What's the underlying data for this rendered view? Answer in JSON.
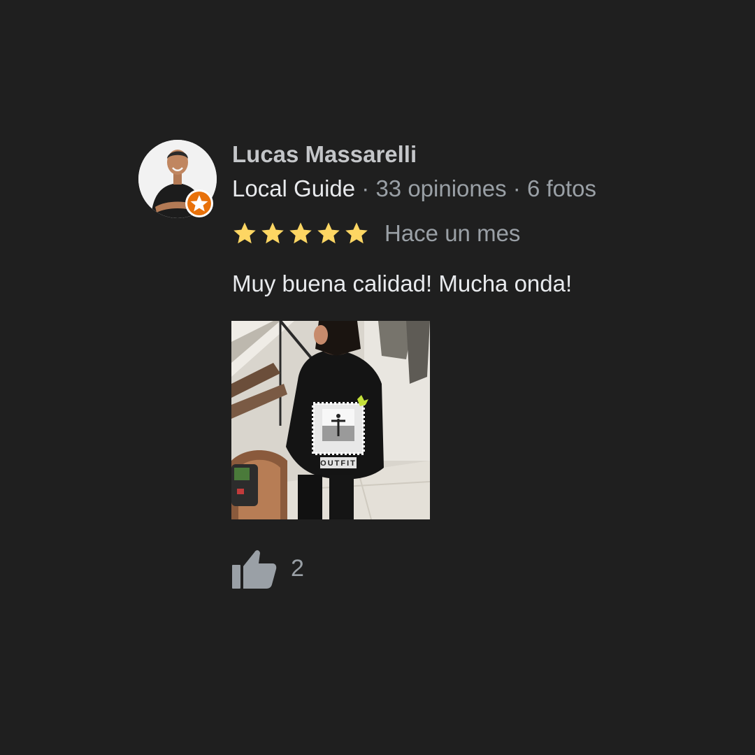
{
  "review": {
    "author_name": "Lucas Massarelli",
    "guide_label": "Local Guide",
    "separator": " · ",
    "reviews_count": "33 opiniones",
    "photos_count": "6 fotos",
    "rating": 5,
    "max_rating": 5,
    "time_ago": "Hace un mes",
    "text": "Muy buena calidad! Mucha onda!",
    "likes": "2",
    "photo_print_text": "OUTFIT"
  },
  "icons": {
    "star": "star-icon",
    "badge": "local-guide-star-icon",
    "like": "thumbs-up-icon"
  },
  "colors": {
    "background": "#1f1f1f",
    "star": "#fdd663",
    "badge": "#e8710a",
    "name": "#c4c6c9",
    "primary_text": "#e8eaed",
    "secondary_text": "#9aa0a6"
  }
}
